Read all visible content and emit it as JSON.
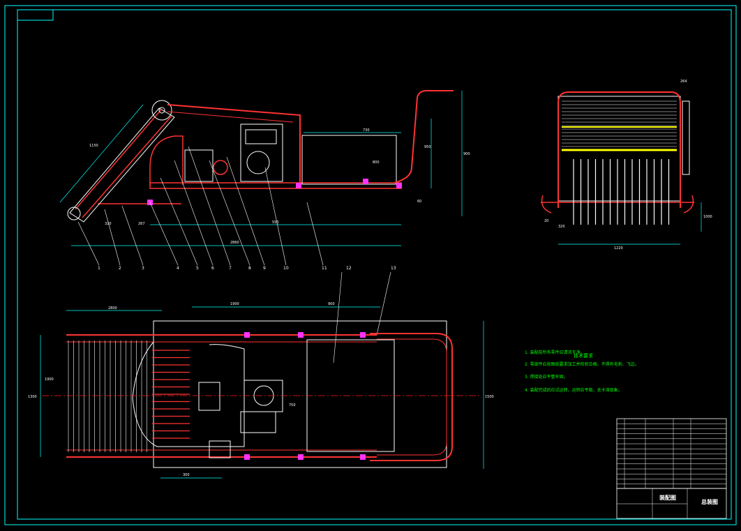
{
  "colors": {
    "background": "#000000",
    "frame": "#00ffff",
    "outline": "#ffffff",
    "member": "#ff3333",
    "centerline": "#ff2222",
    "note": "#00ff00",
    "highlight": "#ffff00",
    "joint": "#ff33ff"
  },
  "tech_requirements": {
    "title": "技术要求",
    "items": [
      "1. 装配前所有零件应清洗干净。",
      "2. 零部件应按图纸要求加工并检验合格，不得有毛刺、飞边。",
      "3. 焊接处应平整牢固。",
      "4. 装配完成后应试运转，运转应平稳，无卡滞现象。"
    ]
  },
  "callouts": [
    "1",
    "2",
    "3",
    "4",
    "5",
    "6",
    "7",
    "8",
    "9",
    "10",
    "11",
    "12",
    "13"
  ],
  "dimensions": {
    "side_view": [
      "2860",
      "730",
      "550",
      "800",
      "900",
      "950",
      "267",
      "1150",
      "60",
      "320"
    ],
    "end_view": [
      "264",
      "1220",
      "1000",
      "320",
      "20"
    ],
    "plan_view": [
      "2800",
      "1900",
      "900",
      "1300",
      "1500",
      "300",
      "1900",
      "750"
    ]
  },
  "title_block": {
    "drawing_title": "装配图",
    "sheet_label": "总装图"
  }
}
